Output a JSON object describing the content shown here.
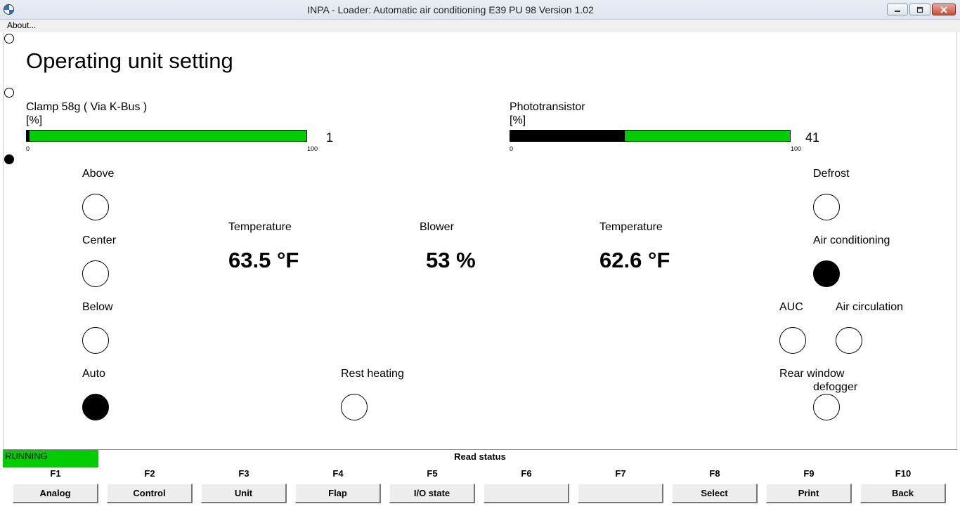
{
  "window": {
    "title": "INPA - Loader:  Automatic air conditioning E39 PU 98 Version 1.02",
    "menu_about": "About..."
  },
  "page": {
    "title": "Operating unit setting"
  },
  "bars": [
    {
      "label": "Clamp 58g ( Via K-Bus )",
      "unit": "[%]",
      "min": "0",
      "max": "100",
      "value": "1",
      "fraction": 0.01
    },
    {
      "label": "Phototransistor",
      "unit": "[%]",
      "min": "0",
      "max": "100",
      "value": "41",
      "fraction": 0.41
    }
  ],
  "indicators": {
    "above": {
      "label": "Above",
      "on": false
    },
    "center": {
      "label": "Center",
      "on": false
    },
    "below": {
      "label": "Below",
      "on": false
    },
    "auto": {
      "label": "Auto",
      "on": true
    },
    "rest_heating": {
      "label": "Rest heating",
      "on": false
    },
    "defrost": {
      "label": "Defrost",
      "on": false
    },
    "air_conditioning": {
      "label": "Air conditioning",
      "on": true
    },
    "auc": {
      "label": "AUC",
      "on": false
    },
    "air_circulation": {
      "label": "Air circulation",
      "on": false
    },
    "rear_window_line1": "Rear window",
    "rear_window_line2": "defogger",
    "rear_window_on": false
  },
  "readings": {
    "temp_left_label": "Temperature",
    "temp_left_value": "63.5 °F",
    "blower_label": "Blower",
    "blower_value": "53 %",
    "temp_right_label": "Temperature",
    "temp_right_value": "62.6 °F"
  },
  "status": {
    "running": "RUNNING",
    "read_status": "Read status",
    "running_color": "#00cc00",
    "bar_color": "#00cc00"
  },
  "function_keys": [
    {
      "key": "F1",
      "label": "Analog"
    },
    {
      "key": "F2",
      "label": "Control"
    },
    {
      "key": "F3",
      "label": "Unit"
    },
    {
      "key": "F4",
      "label": "Flap"
    },
    {
      "key": "F5",
      "label": "I/O state"
    },
    {
      "key": "F6",
      "label": ""
    },
    {
      "key": "F7",
      "label": ""
    },
    {
      "key": "F8",
      "label": "Select"
    },
    {
      "key": "F9",
      "label": "Print"
    },
    {
      "key": "F10",
      "label": "Back"
    }
  ]
}
